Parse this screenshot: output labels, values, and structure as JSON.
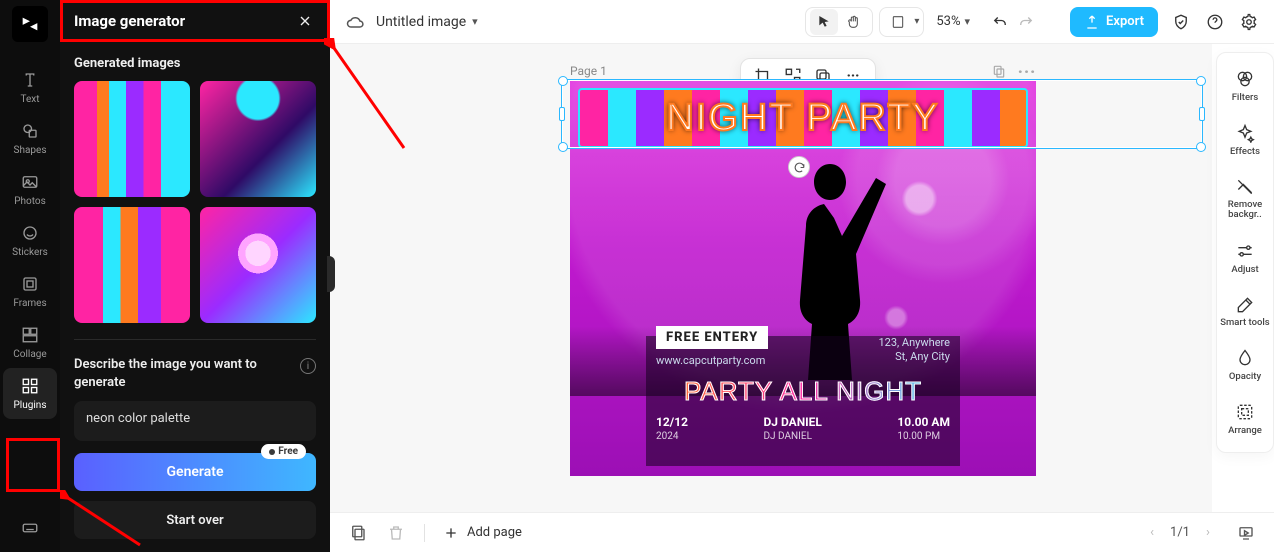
{
  "left_rail": {
    "text": "Text",
    "shapes": "Shapes",
    "photos": "Photos",
    "stickers": "Stickers",
    "frames": "Frames",
    "collage": "Collage",
    "plugins": "Plugins"
  },
  "panel": {
    "title": "Image generator",
    "generated_title": "Generated images",
    "describe_label": "Describe the image you want to generate",
    "prompt_value": "neon color palette",
    "free_badge": "Free",
    "generate_btn": "Generate",
    "start_over_btn": "Start over"
  },
  "topbar": {
    "doc_name": "Untitled image",
    "zoom": "53%",
    "export": "Export"
  },
  "canvas": {
    "page_label": "Page 1",
    "title": "NIGHT PARTY",
    "free_entry": "FREE ENTERY",
    "website": "www.capcutparty.com",
    "address1": "123, Anywhere",
    "address2": "St, Any City",
    "subtitle": "PARTY ALL NIGHT",
    "date1": "12/12",
    "date2": "2024",
    "dj1": "DJ DANIEL",
    "dj2": "DJ DANIEL",
    "time1": "10.00 AM",
    "time2": "10.00 PM"
  },
  "right_rail": {
    "filters": "Filters",
    "effects": "Effects",
    "removebg": "Remove backgr..",
    "adjust": "Adjust",
    "smarttools": "Smart tools",
    "opacity": "Opacity",
    "arrange": "Arrange"
  },
  "bottombar": {
    "add_page": "Add page",
    "page_of": "1/1"
  }
}
